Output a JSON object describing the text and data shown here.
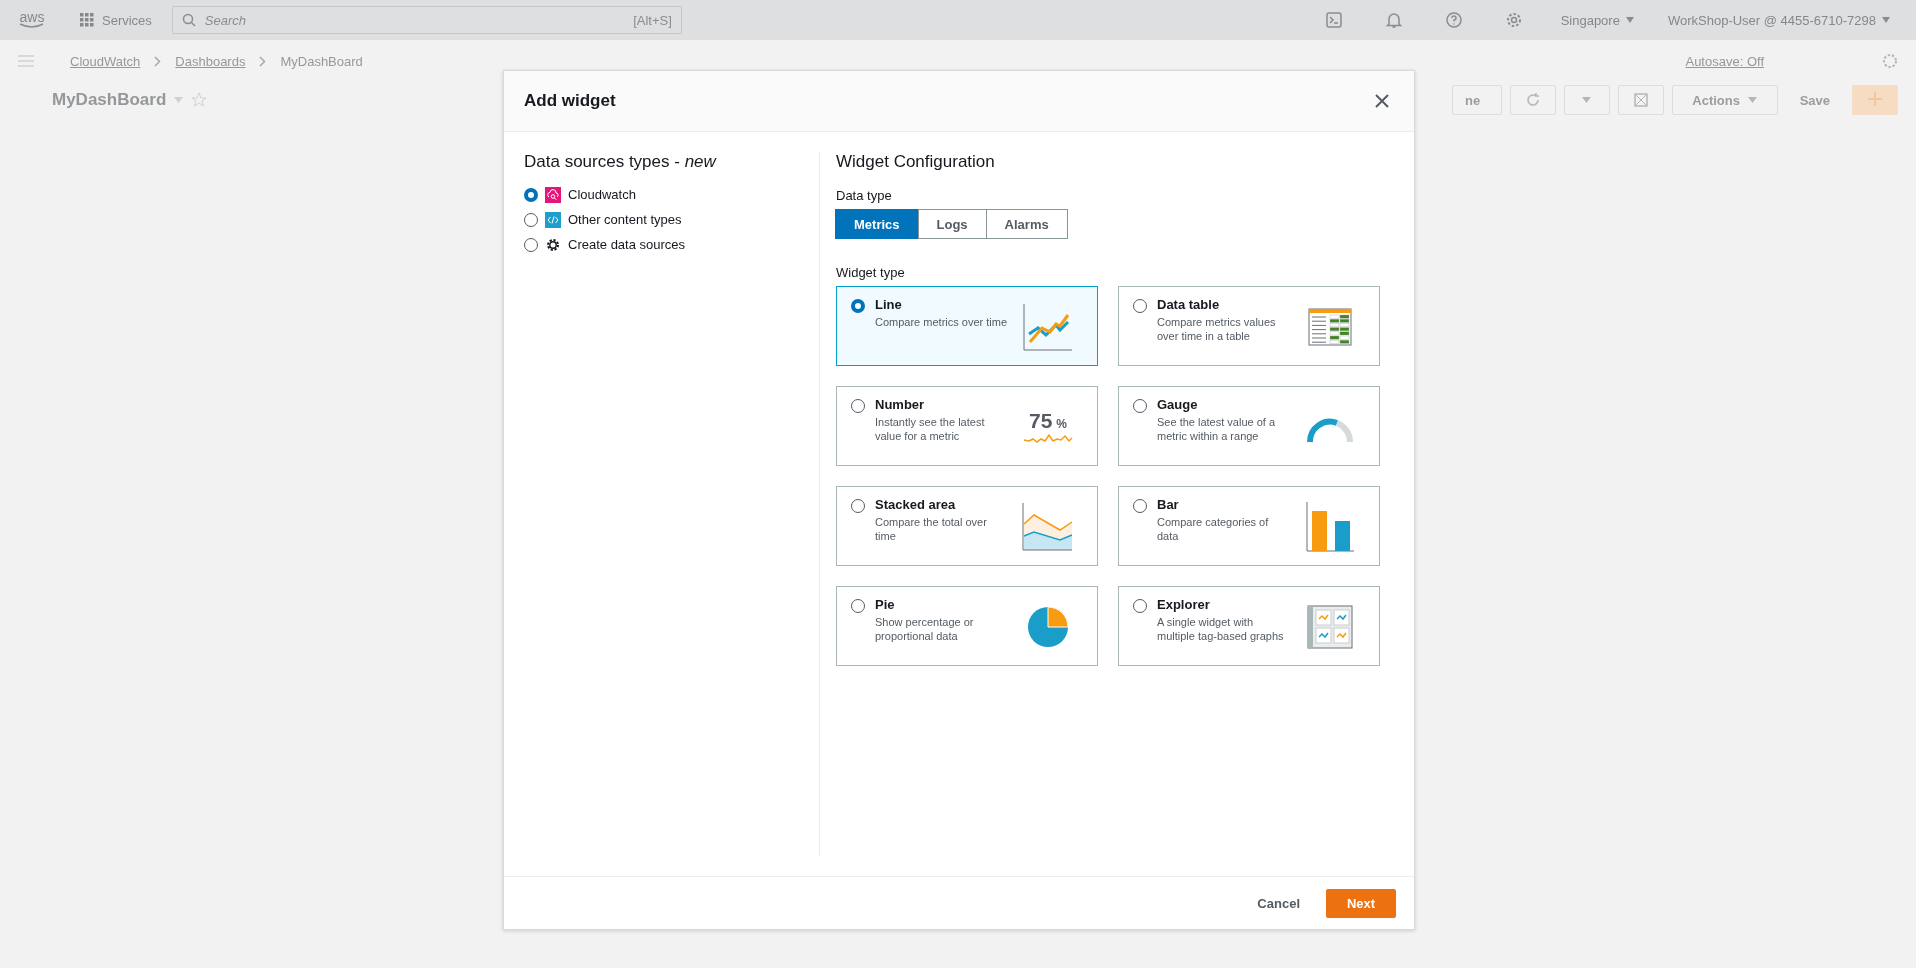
{
  "top_nav": {
    "logo": "aws",
    "services": "Services",
    "search": {
      "placeholder": "Search",
      "shortcut": "[Alt+S]"
    },
    "region": "Singapore",
    "account": "WorkShop-User @ 4455-6710-7298"
  },
  "breadcrumbs": [
    {
      "label": "CloudWatch",
      "link": true
    },
    {
      "label": "Dashboards",
      "link": true
    },
    {
      "label": "MyDashBoard",
      "link": false
    }
  ],
  "dashboard": {
    "title": "MyDashBoard",
    "autosave": "Autosave: Off",
    "time_button": "ne",
    "actions": "Actions",
    "save": "Save"
  },
  "modal": {
    "title": "Add widget",
    "sources_heading": "Data sources types - *new*",
    "sources": [
      {
        "kind": "cloudwatch",
        "label": "Cloudwatch",
        "selected": true
      },
      {
        "kind": "code",
        "label": "Other content types",
        "selected": false
      },
      {
        "kind": "gear",
        "label": "Create data sources",
        "selected": false
      }
    ],
    "config_heading": "Widget Configuration",
    "data_type_label": "Data type",
    "data_types": [
      {
        "label": "Metrics",
        "selected": true
      },
      {
        "label": "Logs",
        "selected": false
      },
      {
        "label": "Alarms",
        "selected": false
      }
    ],
    "widget_type_label": "Widget type",
    "widgets": [
      {
        "kind": "line",
        "name": "Line",
        "description": "Compare metrics over time",
        "selected": true
      },
      {
        "kind": "table",
        "name": "Data table",
        "description": "Compare metrics values over time in a table",
        "selected": false
      },
      {
        "kind": "number",
        "name": "Number",
        "description": "Instantly see the latest value for a metric",
        "selected": false,
        "figure": "75",
        "unit": "%"
      },
      {
        "kind": "gauge",
        "name": "Gauge",
        "description": "See the latest value of a metric within a range",
        "selected": false
      },
      {
        "kind": "stacked_area",
        "name": "Stacked area",
        "description": "Compare the total over time",
        "selected": false
      },
      {
        "kind": "bar",
        "name": "Bar",
        "description": "Compare categories of data",
        "selected": false
      },
      {
        "kind": "pie",
        "name": "Pie",
        "description": "Show percentage or proportional data",
        "selected": false
      },
      {
        "kind": "explorer",
        "name": "Explorer",
        "description": "A single widget with multiple tag-based graphs",
        "selected": false
      }
    ],
    "cancel": "Cancel",
    "next": "Next"
  }
}
